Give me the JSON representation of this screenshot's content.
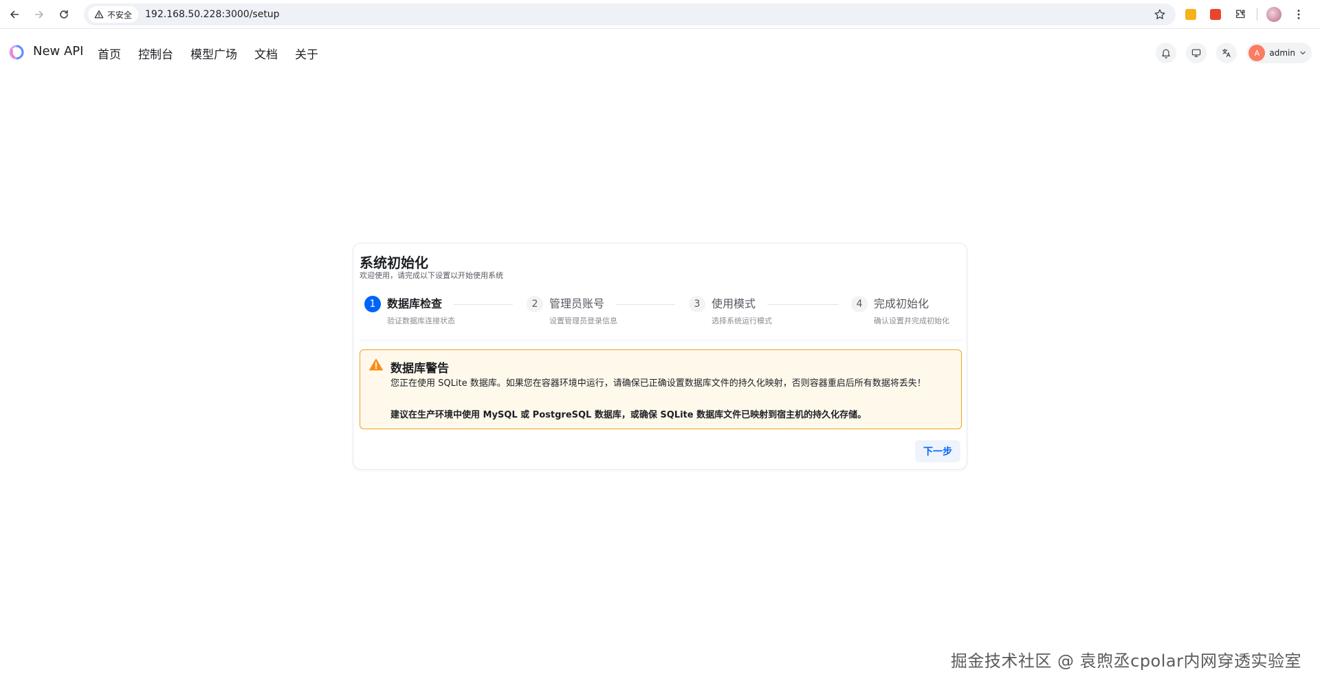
{
  "browser": {
    "security_label": "不安全",
    "url": "192.168.50.228:3000/setup"
  },
  "header": {
    "brand": "New API",
    "nav": [
      "首页",
      "控制台",
      "模型广场",
      "文档",
      "关于"
    ],
    "user": {
      "avatar_letter": "A",
      "name": "admin"
    }
  },
  "setup": {
    "title": "系统初始化",
    "subtitle": "欢迎使用，请完成以下设置以开始使用系统",
    "steps": [
      {
        "num": "1",
        "title": "数据库检查",
        "desc": "验证数据库连接状态"
      },
      {
        "num": "2",
        "title": "管理员账号",
        "desc": "设置管理员登录信息"
      },
      {
        "num": "3",
        "title": "使用模式",
        "desc": "选择系统运行模式"
      },
      {
        "num": "4",
        "title": "完成初始化",
        "desc": "确认设置并完成初始化"
      }
    ],
    "active_step": 1,
    "warning": {
      "title": "数据库警告",
      "text": "您正在使用 SQLite 数据库。如果您在容器环境中运行，请确保已正确设置数据库文件的持久化映射，否则容器重启后所有数据将丢失！",
      "strong": "建议在生产环境中使用 MySQL 或 PostgreSQL 数据库，或确保 SQLite 数据库文件已映射到宿主机的持久化存储。"
    },
    "next_label": "下一步"
  },
  "watermark": "掘金技术社区 @ 袁煦丞cpolar内网穿透实验室",
  "colors": {
    "primary": "#0064fa",
    "warning_border": "#f0a020",
    "warning_bg": "#fff9ec",
    "avatar": "#fb7c61"
  }
}
